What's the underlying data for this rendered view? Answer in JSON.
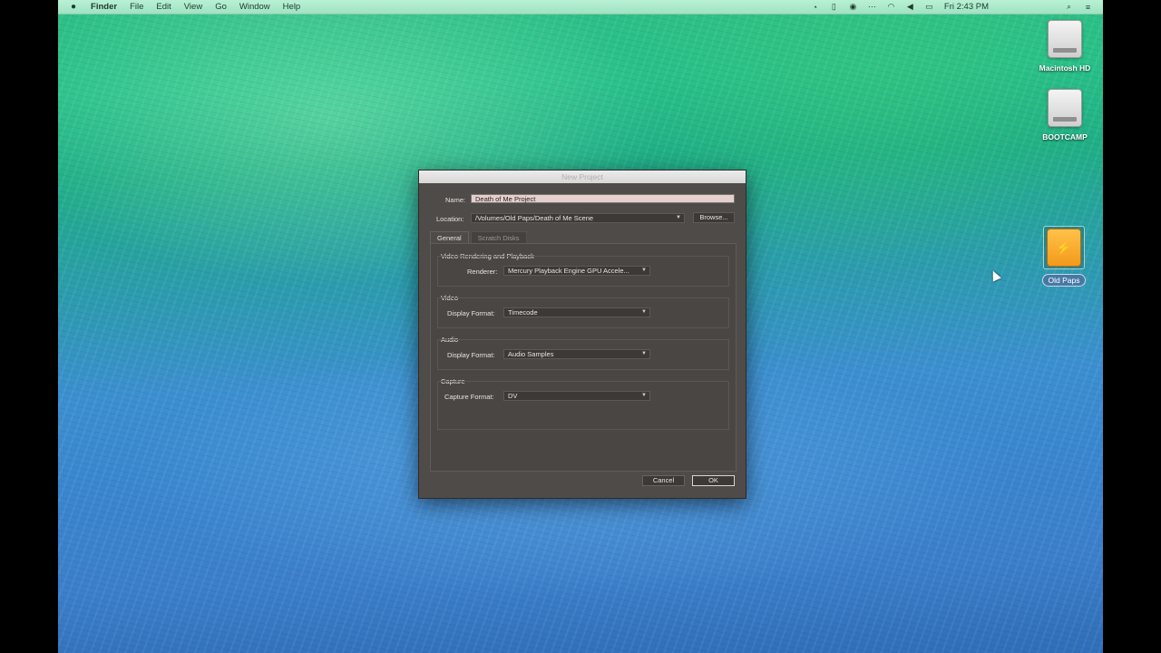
{
  "menubar": {
    "apple": "",
    "app": "Finder",
    "items": [
      "File",
      "Edit",
      "View",
      "Go",
      "Window",
      "Help"
    ],
    "clock": "Fri 2:43 PM",
    "search_icon": "🔍",
    "list_icon": "☰"
  },
  "desktop": {
    "icons": [
      {
        "label": "Macintosh HD"
      },
      {
        "label": "BOOTCAMP"
      },
      {
        "label": "Old Paps"
      }
    ]
  },
  "dialog": {
    "title": "New Project",
    "name_label": "Name:",
    "name_value": "Death of Me Project",
    "location_label": "Location:",
    "location_value": "/Volumes/Old Paps/Death of Me Scene",
    "browse_label": "Browse...",
    "tabs": [
      "General",
      "Scratch Disks"
    ],
    "sections": {
      "rendering": {
        "title": "Video Rendering and Playback",
        "label": "Renderer:",
        "value": "Mercury Playback Engine GPU Accele..."
      },
      "video": {
        "title": "Video",
        "label": "Display Format:",
        "value": "Timecode"
      },
      "audio": {
        "title": "Audio",
        "label": "Display Format:",
        "value": "Audio Samples"
      },
      "capture": {
        "title": "Capture",
        "label": "Capture Format:",
        "value": "DV"
      }
    },
    "cancel_label": "Cancel",
    "ok_label": "OK"
  }
}
